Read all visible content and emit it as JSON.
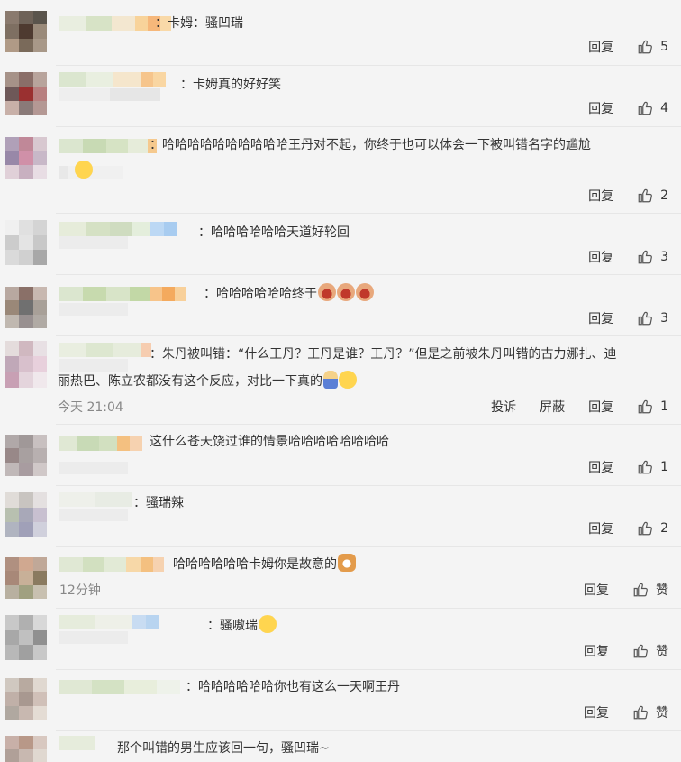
{
  "actions": {
    "reply": "回复",
    "report": "投诉",
    "block": "屏蔽",
    "like_zero": "赞"
  },
  "comments": [
    {
      "text": "：卡姆：骚凹瑞",
      "likes": "5"
    },
    {
      "text": "：卡姆真的好好笑",
      "likes": "4"
    },
    {
      "text": "：哈哈哈哈哈哈哈哈哈哈王丹对不起，你终于也可以体会一下被叫错名字的尴尬",
      "likes": "2"
    },
    {
      "text": "：哈哈哈哈哈哈天道好轮回",
      "likes": "3"
    },
    {
      "text": "：哈哈哈哈哈哈终于",
      "likes": "3"
    },
    {
      "text_line1": "：朱丹被叫错：“什么王丹？王丹是谁？王丹？”但是之前被朱丹叫错的古力娜扎、迪",
      "text_line2": "丽热巴、陈立农都没有这个反应，对比一下真的",
      "time": "今天 21:04",
      "likes": "1"
    },
    {
      "text": "这什么苍天饶过谁的情景哈哈哈哈哈哈哈哈",
      "likes": "1"
    },
    {
      "text": "：骚瑞辣",
      "likes": "2"
    },
    {
      "text": "哈哈哈哈哈哈卡姆你是故意的",
      "time": "12分钟",
      "likes": "赞"
    },
    {
      "text": "：骚嗷瑞",
      "likes": "赞"
    },
    {
      "text": "：哈哈哈哈哈哈你也有这么一天啊王丹",
      "likes": "赞"
    },
    {
      "text": "那个叫错的男生应该回一句，骚凹瑞~"
    }
  ],
  "colors": {
    "background": "#f4f4f4",
    "text": "#333333",
    "muted": "#888888",
    "divider": "#e6e6e6"
  }
}
